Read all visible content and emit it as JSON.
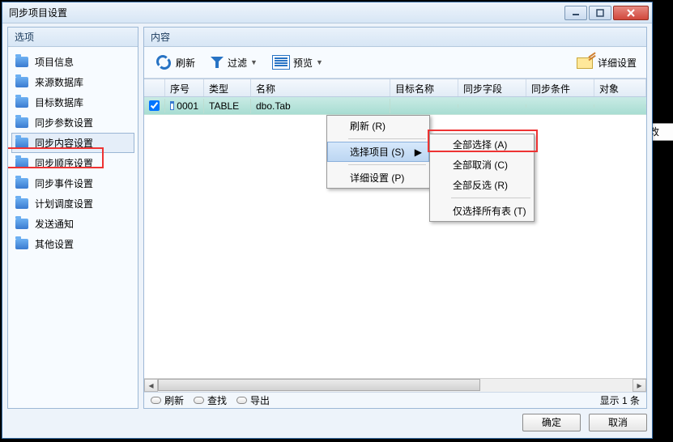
{
  "window": {
    "title": "同步项目设置"
  },
  "side": {
    "header": "选项",
    "items": [
      {
        "label": "项目信息"
      },
      {
        "label": "来源数据库"
      },
      {
        "label": "目标数据库"
      },
      {
        "label": "同步参数设置"
      },
      {
        "label": "同步内容设置"
      },
      {
        "label": "同步顺序设置"
      },
      {
        "label": "同步事件设置"
      },
      {
        "label": "计划调度设置"
      },
      {
        "label": "发送通知"
      },
      {
        "label": "其他设置"
      }
    ]
  },
  "main": {
    "header": "内容",
    "toolbar": {
      "refresh": "刷新",
      "filter": "过滤",
      "preview": "预览",
      "detail": "详细设置"
    },
    "grid": {
      "headers": {
        "seq": "序号",
        "type": "类型",
        "name": "名称",
        "target": "目标名称",
        "field": "同步字段",
        "cond": "同步条件",
        "obj": "对象"
      },
      "row": {
        "seq": "0001",
        "type": "TABLE",
        "name": "dbo.Tab"
      }
    },
    "status": {
      "refresh": "刷新",
      "find": "查找",
      "export": "导出",
      "count": "显示 1 条"
    }
  },
  "menu1": {
    "refresh": "刷新 (R)",
    "select": "选择项目 (S)",
    "detail": "详细设置 (P)"
  },
  "menu2": {
    "all": "全部选择 (A)",
    "none": "全部取消 (C)",
    "invert": "全部反选 (R)",
    "tables": "仅选择所有表 (T)"
  },
  "footer": {
    "ok": "确定",
    "cancel": "取消"
  },
  "bg_button": "改"
}
